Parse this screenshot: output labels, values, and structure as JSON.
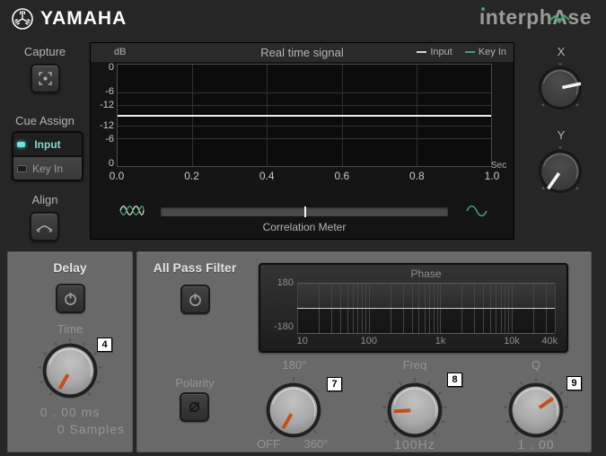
{
  "header": {
    "brand": "YAMAHA",
    "product_pre": "ınterph",
    "product_a": "A",
    "product_post": "se"
  },
  "left_panel": {
    "capture_label": "Capture",
    "cue_assign_label": "Cue Assign",
    "cue_options": [
      {
        "label": "Input",
        "active": true
      },
      {
        "label": "Key In",
        "active": false
      }
    ],
    "align_label": "Align"
  },
  "scope": {
    "unit": "dB",
    "title": "Real time signal",
    "legend": [
      {
        "label": "Input",
        "color": "#d8d8d8"
      },
      {
        "label": "Key In",
        "color": "#43a06c"
      }
    ],
    "y_ticks_top": [
      "0",
      "-6",
      "-12"
    ],
    "y_ticks_bottom": [
      "-12",
      "-6",
      "0"
    ],
    "x_ticks": [
      "0.0",
      "0.2",
      "0.4",
      "0.6",
      "0.8",
      "1.0"
    ],
    "x_unit": "Sec"
  },
  "correlation": {
    "label": "Correlation Meter"
  },
  "xy_pad": {
    "x_label": "X",
    "y_label": "Y"
  },
  "delay": {
    "title": "Delay",
    "time_label": "Time",
    "badge": "4",
    "value_ms": "0 . 00 ms",
    "value_samples": "0 Samples"
  },
  "allpass": {
    "title": "All Pass Filter",
    "polarity_label": "Polarity",
    "phase_display": {
      "title": "Phase",
      "y_max": "180",
      "y_min": "-180",
      "x_ticks": [
        "10",
        "100",
        "1k",
        "10k",
        "40k"
      ]
    },
    "degree_knob": {
      "label": "180°",
      "min": "OFF",
      "max": "360°",
      "badge": "7"
    },
    "freq_knob": {
      "label": "Freq",
      "value": "100Hz",
      "badge": "8"
    },
    "q_knob": {
      "label": "Q",
      "value": "1 . 00",
      "badge": "9"
    }
  },
  "colors": {
    "accent_green": "#43a06c",
    "accent_cyan": "#7fd8d2",
    "pointer_orange": "#c44f1e",
    "top_background": "#262626",
    "panel_gray": "#696969"
  }
}
